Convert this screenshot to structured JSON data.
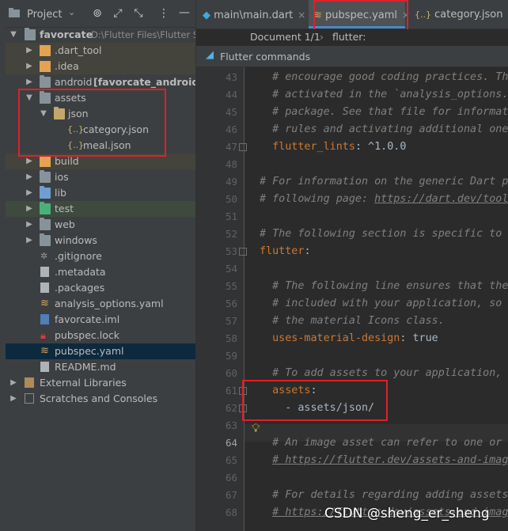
{
  "project_panel": {
    "title": "Project",
    "root_name": "favorcate",
    "root_path": "D:\\Flutter Files\\Flutter S",
    "items": [
      {
        "label": "favorcate",
        "extra": "D:\\Flutter Files\\Flutter S"
      },
      {
        "label": ".dart_tool"
      },
      {
        "label": ".idea"
      },
      {
        "label": "android",
        "extra": "[favorcate_android]"
      },
      {
        "label": "assets"
      },
      {
        "label": "json"
      },
      {
        "label": "category.json"
      },
      {
        "label": "meal.json"
      },
      {
        "label": "build"
      },
      {
        "label": "ios"
      },
      {
        "label": "lib"
      },
      {
        "label": "test"
      },
      {
        "label": "web"
      },
      {
        "label": "windows"
      },
      {
        "label": ".gitignore"
      },
      {
        "label": ".metadata"
      },
      {
        "label": ".packages"
      },
      {
        "label": "analysis_options.yaml"
      },
      {
        "label": "favorcate.iml"
      },
      {
        "label": "pubspec.lock"
      },
      {
        "label": "pubspec.yaml"
      },
      {
        "label": "README.md"
      },
      {
        "label": "External Libraries"
      },
      {
        "label": "Scratches and Consoles"
      }
    ]
  },
  "tabs": [
    {
      "label": "main\\main.dart"
    },
    {
      "label": "pubspec.yaml"
    },
    {
      "label": "category.json"
    }
  ],
  "breadcrumb": {
    "doc": "Document 1/1",
    "sep": "›",
    "node": "flutter:"
  },
  "flutter_bar": {
    "label": "Flutter commands"
  },
  "editor": {
    "lines": [
      {
        "n": "43",
        "text": "  # encourage good coding practices. The "
      },
      {
        "n": "44",
        "text": "  # activated in the `analysis_options.yam"
      },
      {
        "n": "45",
        "text": "  # package. See that file for information"
      },
      {
        "n": "46",
        "text": "  # rules and activating additional ones."
      },
      {
        "n": "47",
        "key": "  flutter_lints",
        "value": ": ^1.0.0"
      },
      {
        "n": "48",
        "text": ""
      },
      {
        "n": "49",
        "text": "# For information on the generic Dart par"
      },
      {
        "n": "50",
        "text": "# following page: ",
        "link": "https://dart.dev/tools/p"
      },
      {
        "n": "51",
        "text": ""
      },
      {
        "n": "52",
        "text": "# The following section is specific to Fl"
      },
      {
        "n": "53",
        "key": "flutter",
        "value": ":"
      },
      {
        "n": "54",
        "text": ""
      },
      {
        "n": "55",
        "text": "  # The following line ensures that the Ma"
      },
      {
        "n": "56",
        "text": "  # included with your application, so the"
      },
      {
        "n": "57",
        "text": "  # the material Icons class."
      },
      {
        "n": "58",
        "key": "  uses-material-design",
        "value": ": true"
      },
      {
        "n": "59",
        "text": ""
      },
      {
        "n": "60",
        "text": "  # To add assets to your application, add"
      },
      {
        "n": "61",
        "key": "  assets",
        "value": ":"
      },
      {
        "n": "62",
        "value": "    - assets/json/"
      },
      {
        "n": "63",
        "text": ""
      },
      {
        "n": "64",
        "text": "  # An image asset can refer to one or mor"
      },
      {
        "n": "65",
        "text": "  ",
        "link": "# https://flutter.dev/assets-and-images/"
      },
      {
        "n": "66",
        "text": ""
      },
      {
        "n": "67",
        "text": "  # For details regarding adding assets fr"
      },
      {
        "n": "68",
        "text": "  ",
        "link": "# https://flutter.dev/assets-and-images/"
      }
    ],
    "current_line": "64"
  },
  "watermark": "CSDN @sheng_er_sheng"
}
